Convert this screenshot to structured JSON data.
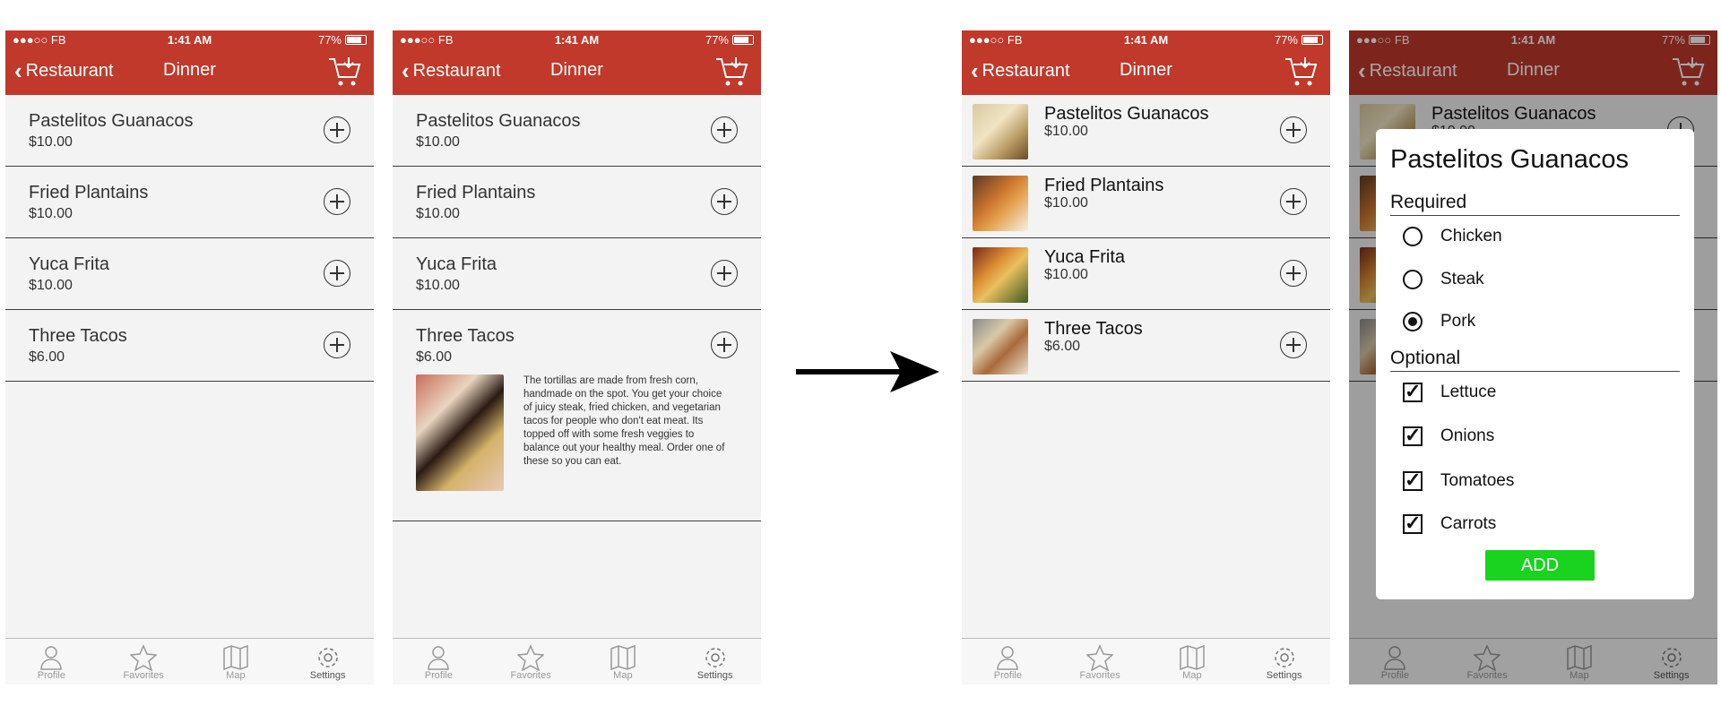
{
  "status": {
    "carrier": "●●●○○ FB",
    "time": "1:41 AM",
    "battery": "77%"
  },
  "nav": {
    "back_label": "Restaurant",
    "title": "Dinner"
  },
  "items": [
    {
      "name": "Pastelitos Guanacos",
      "price": "$10.00"
    },
    {
      "name": "Fried Plantains",
      "price": "$10.00"
    },
    {
      "name": "Yuca Frita",
      "price": "$10.00"
    },
    {
      "name": "Three Tacos",
      "price": "$6.00"
    }
  ],
  "description": "The tortillas are made from fresh corn, handmade on the spot. You get your choice of juicy steak, fried chicken, and vegetarian tacos for people who don't eat meat. Its topped off with some fresh veggies to balance out your healthy meal. Order one of these so you can eat.",
  "tabs": [
    "Profile",
    "Favorites",
    "Map",
    "Settings"
  ],
  "dialog": {
    "title": "Pastelitos Guanacos",
    "required_label": "Required",
    "required_options": [
      {
        "label": "Chicken",
        "selected": false
      },
      {
        "label": "Steak",
        "selected": false
      },
      {
        "label": "Pork",
        "selected": true
      }
    ],
    "optional_label": "Optional",
    "optional_options": [
      {
        "label": "Lettuce",
        "checked": true
      },
      {
        "label": "Onions",
        "checked": true
      },
      {
        "label": "Tomatoes",
        "checked": true
      },
      {
        "label": "Carrots",
        "checked": true
      }
    ],
    "add_label": "ADD",
    "add_color": "#19d31e"
  },
  "colors": {
    "accent": "#c0392b"
  }
}
